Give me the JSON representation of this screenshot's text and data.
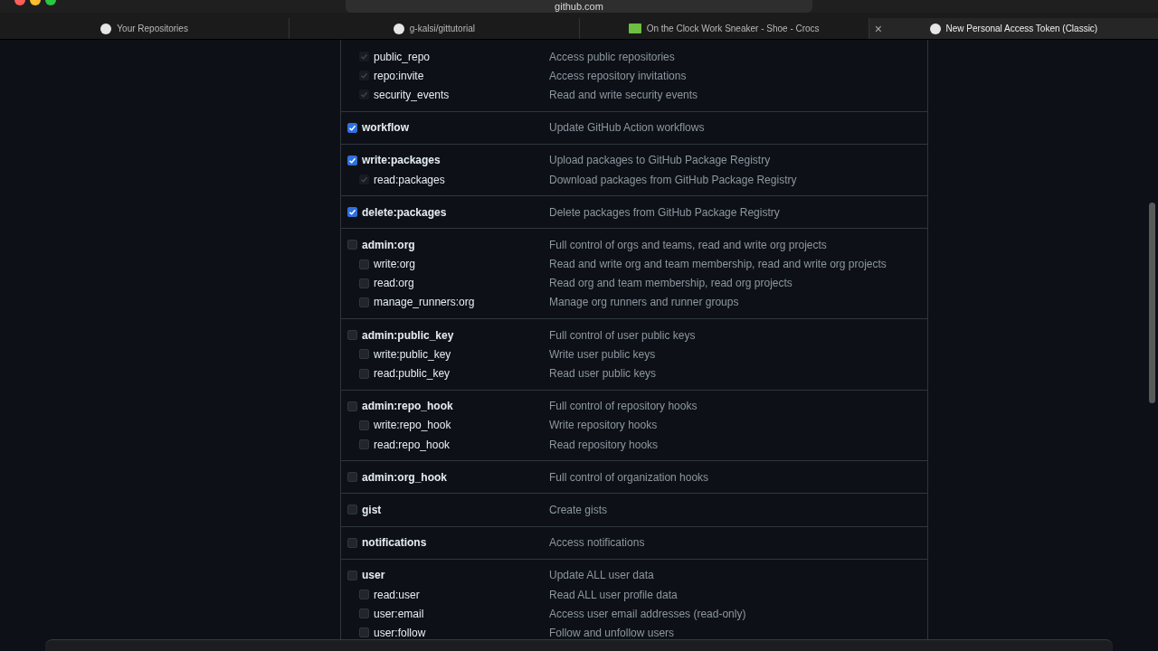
{
  "browser": {
    "address": "github.com",
    "tabs": [
      {
        "title": "Your Repositories",
        "selected": false
      },
      {
        "title": "g-kalsi/gittutorial",
        "selected": false
      },
      {
        "title": "On the Clock Work Sneaker - Shoe - Crocs",
        "selected": false
      },
      {
        "title": "New Personal Access Token (Classic)",
        "selected": true,
        "close": "×"
      }
    ]
  },
  "scopes": [
    {
      "children": [
        {
          "name": "public_repo",
          "description": "Access public repositories",
          "checked": true,
          "disabled": true
        },
        {
          "name": "repo:invite",
          "description": "Access repository invitations",
          "checked": true,
          "disabled": true
        },
        {
          "name": "security_events",
          "description": "Read and write security events",
          "checked": true,
          "disabled": true
        }
      ]
    },
    {
      "name": "workflow",
      "description": "Update GitHub Action workflows",
      "checked": true
    },
    {
      "name": "write:packages",
      "description": "Upload packages to GitHub Package Registry",
      "checked": true,
      "children": [
        {
          "name": "read:packages",
          "description": "Download packages from GitHub Package Registry",
          "checked": true,
          "disabled": true
        }
      ]
    },
    {
      "name": "delete:packages",
      "description": "Delete packages from GitHub Package Registry",
      "checked": true
    },
    {
      "name": "admin:org",
      "description": "Full control of orgs and teams, read and write org projects",
      "checked": false,
      "children": [
        {
          "name": "write:org",
          "description": "Read and write org and team membership, read and write org projects",
          "checked": false,
          "disabled": false
        },
        {
          "name": "read:org",
          "description": "Read org and team membership, read org projects",
          "checked": false,
          "disabled": false
        },
        {
          "name": "manage_runners:org",
          "description": "Manage org runners and runner groups",
          "checked": false,
          "disabled": false
        }
      ]
    },
    {
      "name": "admin:public_key",
      "description": "Full control of user public keys",
      "checked": false,
      "children": [
        {
          "name": "write:public_key",
          "description": "Write user public keys",
          "checked": false,
          "disabled": false
        },
        {
          "name": "read:public_key",
          "description": "Read user public keys",
          "checked": false,
          "disabled": false
        }
      ]
    },
    {
      "name": "admin:repo_hook",
      "description": "Full control of repository hooks",
      "checked": false,
      "children": [
        {
          "name": "write:repo_hook",
          "description": "Write repository hooks",
          "checked": false,
          "disabled": false
        },
        {
          "name": "read:repo_hook",
          "description": "Read repository hooks",
          "checked": false,
          "disabled": false
        }
      ]
    },
    {
      "name": "admin:org_hook",
      "description": "Full control of organization hooks",
      "checked": false
    },
    {
      "name": "gist",
      "description": "Create gists",
      "checked": false
    },
    {
      "name": "notifications",
      "description": "Access notifications",
      "checked": false
    },
    {
      "name": "user",
      "description": "Update ALL user data",
      "checked": false,
      "children": [
        {
          "name": "read:user",
          "description": "Read ALL user profile data",
          "checked": false,
          "disabled": false
        },
        {
          "name": "user:email",
          "description": "Access user email addresses (read-only)",
          "checked": false,
          "disabled": false
        },
        {
          "name": "user:follow",
          "description": "Follow and unfollow users",
          "checked": false,
          "disabled": false
        }
      ]
    }
  ]
}
